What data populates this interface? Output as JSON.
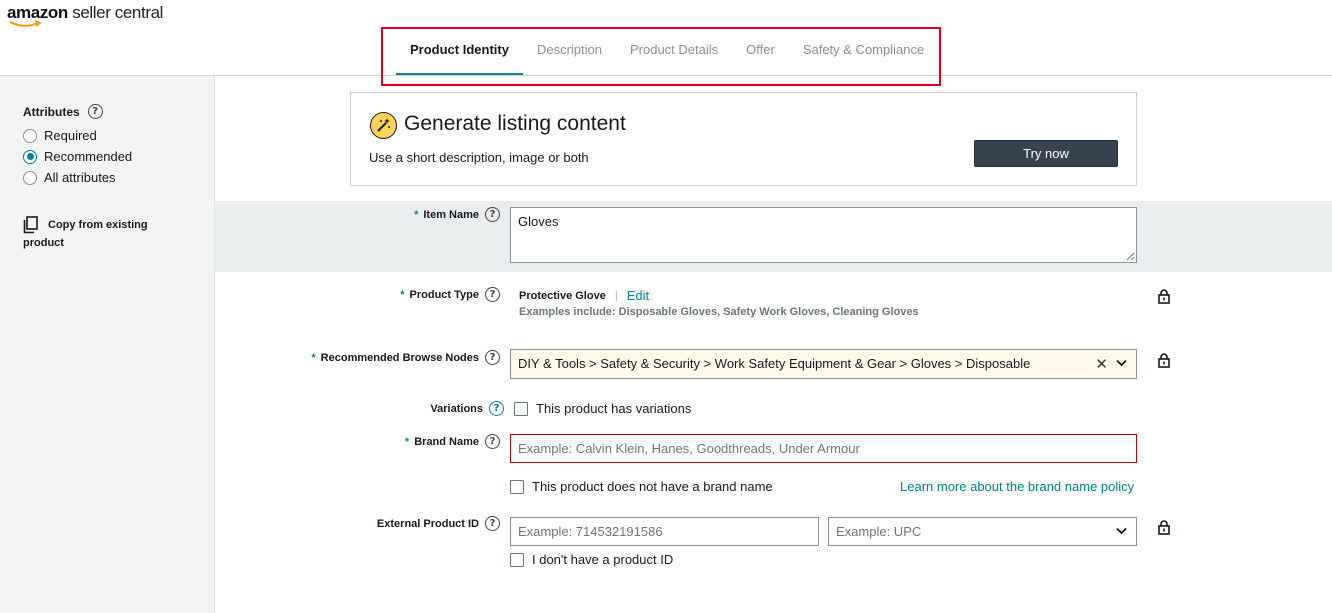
{
  "app": {
    "brand": "amazon",
    "product": "seller central"
  },
  "tabs": [
    {
      "label": "Product Identity",
      "active": true
    },
    {
      "label": "Description",
      "active": false
    },
    {
      "label": "Product Details",
      "active": false
    },
    {
      "label": "Offer",
      "active": false
    },
    {
      "label": "Safety & Compliance",
      "active": false
    }
  ],
  "sidebar": {
    "title": "Attributes",
    "options": [
      {
        "label": "Required",
        "checked": false
      },
      {
        "label": "Recommended",
        "checked": true
      },
      {
        "label": "All attributes",
        "checked": false
      }
    ],
    "copy_line1": "Copy from existing",
    "copy_line2": "product"
  },
  "generate": {
    "title": "Generate listing content",
    "subtitle": "Use a short description, image or both",
    "button": "Try now"
  },
  "form": {
    "item_name": {
      "label": "Item Name",
      "value": "Gloves"
    },
    "product_type": {
      "label": "Product Type",
      "value": "Protective Glove",
      "edit": "Edit",
      "examples": "Examples include: Disposable Gloves, Safety Work Gloves, Cleaning Gloves"
    },
    "browse_nodes": {
      "label": "Recommended Browse Nodes",
      "value": "DIY & Tools > Safety & Security > Work Safety Equipment & Gear > Gloves > Disposable"
    },
    "variations": {
      "label": "Variations",
      "checkbox": "This product has variations"
    },
    "brand_name": {
      "label": "Brand Name",
      "placeholder": "Example: Calvin Klein, Hanes, Goodthreads, Under Armour",
      "no_brand": "This product does not have a brand name",
      "policy_link": "Learn more about the brand name policy"
    },
    "external_id": {
      "label": "External Product ID",
      "placeholder": "Example: 714532191586",
      "type_placeholder": "Example: UPC",
      "no_id": "I don't have a product ID"
    }
  },
  "colors": {
    "accent": "#008296",
    "highlight": "#e3001b",
    "button_bg": "#37444f",
    "error": "#c40000"
  }
}
